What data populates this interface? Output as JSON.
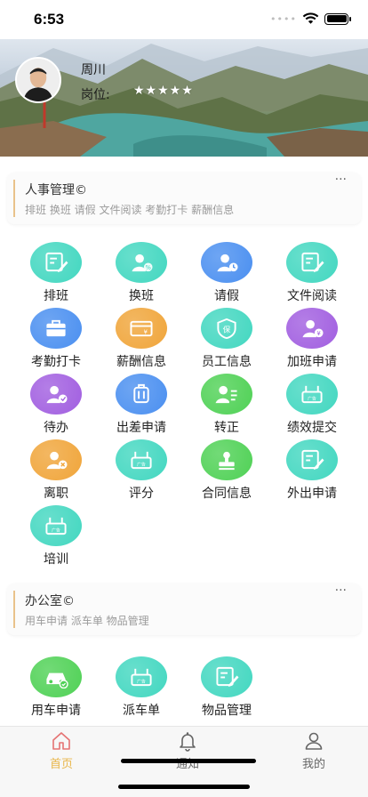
{
  "status": {
    "time": "6:53"
  },
  "profile": {
    "name": "周川",
    "post_label": "岗位:",
    "stars": "★★★★★"
  },
  "sections": {
    "hr": {
      "title": "人事管理©",
      "subtitle": "排班 换班 请假 文件阅读 考勤打卡 薪酬信息",
      "more": "···"
    },
    "office": {
      "title": "办公室©",
      "subtitle": "用车申请 派车单 物品管理",
      "more": "···"
    }
  },
  "hr_tiles": [
    {
      "label": "排班",
      "icon": "edit-note-icon",
      "color": "#42d7c0"
    },
    {
      "label": "换班",
      "icon": "user-exchange-icon",
      "color": "#42d7c0"
    },
    {
      "label": "请假",
      "icon": "user-clock-icon",
      "color": "#4a8ff0"
    },
    {
      "label": "文件阅读",
      "icon": "edit-note-icon",
      "color": "#42d7c0"
    },
    {
      "label": "考勤打卡",
      "icon": "briefcase-icon",
      "color": "#4a8ff0"
    },
    {
      "label": "薪酬信息",
      "icon": "salary-card-icon",
      "color": "#f0a53a"
    },
    {
      "label": "员工信息",
      "icon": "shield-icon",
      "color": "#42d7c0"
    },
    {
      "label": "加班申请",
      "icon": "user-overtime-icon",
      "color": "#a15ee0"
    },
    {
      "label": "待办",
      "icon": "user-pending-icon",
      "color": "#a15ee0"
    },
    {
      "label": "出差申请",
      "icon": "luggage-icon",
      "color": "#4a8ff0"
    },
    {
      "label": "转正",
      "icon": "user-card-icon",
      "color": "#4fd155"
    },
    {
      "label": "绩效提交",
      "icon": "router-icon",
      "color": "#42d7c0"
    },
    {
      "label": "离职",
      "icon": "user-remove-icon",
      "color": "#f0a53a"
    },
    {
      "label": "评分",
      "icon": "router-icon",
      "color": "#42d7c0"
    },
    {
      "label": "合同信息",
      "icon": "stamp-icon",
      "color": "#4fd155"
    },
    {
      "label": "外出申请",
      "icon": "edit-note-icon",
      "color": "#42d7c0"
    },
    {
      "label": "培训",
      "icon": "router-icon",
      "color": "#42d7c0"
    }
  ],
  "office_tiles": [
    {
      "label": "用车申请",
      "icon": "car-icon",
      "color": "#4fd155"
    },
    {
      "label": "派车单",
      "icon": "router-icon",
      "color": "#42d7c0"
    },
    {
      "label": "物品管理",
      "icon": "edit-note-icon",
      "color": "#42d7c0"
    }
  ],
  "tabs": [
    {
      "label": "首页",
      "icon": "home-icon",
      "active": true
    },
    {
      "label": "通知",
      "icon": "bell-icon",
      "active": false
    },
    {
      "label": "我的",
      "icon": "profile-icon",
      "active": false
    }
  ],
  "colors": {
    "accent": "#e8b64a",
    "teal": "#42d7c0",
    "blue": "#4a8ff0",
    "orange": "#f0a53a",
    "purple": "#a15ee0",
    "green": "#4fd155"
  }
}
